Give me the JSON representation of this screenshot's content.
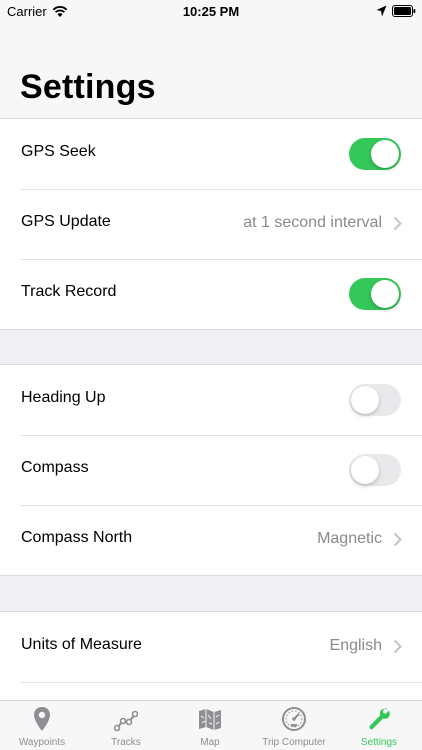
{
  "status_bar": {
    "carrier": "Carrier",
    "time": "10:25 PM"
  },
  "header": {
    "title": "Settings"
  },
  "groups": [
    {
      "rows": [
        {
          "label": "GPS Seek",
          "toggle": true
        },
        {
          "label": "GPS Update",
          "value": "at 1 second interval"
        },
        {
          "label": "Track Record",
          "toggle": true
        }
      ]
    },
    {
      "rows": [
        {
          "label": "Heading Up",
          "toggle": false
        },
        {
          "label": "Compass",
          "toggle": false
        },
        {
          "label": "Compass North",
          "value": "Magnetic"
        }
      ]
    },
    {
      "rows": [
        {
          "label": "Units of Measure",
          "value": "English"
        }
      ]
    }
  ],
  "tab_bar": {
    "tabs": [
      {
        "label": "Waypoints",
        "icon": "map-pin-icon",
        "active": false
      },
      {
        "label": "Tracks",
        "icon": "track-icon",
        "active": false
      },
      {
        "label": "Map",
        "icon": "map-icon",
        "active": false
      },
      {
        "label": "Trip Computer",
        "icon": "speedometer-icon",
        "active": false
      },
      {
        "label": "Settings",
        "icon": "wrench-icon",
        "active": true
      }
    ]
  },
  "colors": {
    "accent": "#34c759",
    "toggle_off": "#e9e9eb",
    "secondary_text": "#8a8a8e",
    "background": "#efeff4"
  }
}
